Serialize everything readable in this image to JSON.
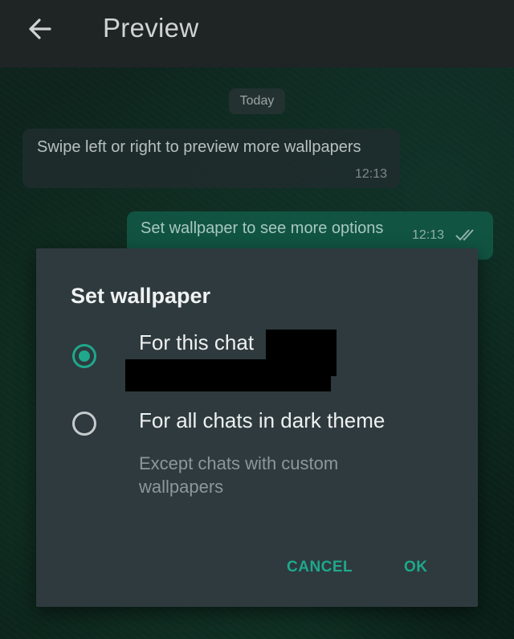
{
  "topbar": {
    "title": "Preview",
    "back_icon": "arrow-left-icon"
  },
  "chat": {
    "date_chip": "Today",
    "incoming": {
      "text": "Swipe left or right to preview more wallpapers",
      "time": "12:13"
    },
    "outgoing": {
      "text": "Set wallpaper to see more options",
      "time": "12:13",
      "status_icon": "double-check-icon"
    }
  },
  "dialog": {
    "title": "Set wallpaper",
    "options": [
      {
        "label": "For this chat",
        "selected": true
      },
      {
        "label": "For all chats in dark theme",
        "subtext": "Except chats with custom wallpapers",
        "selected": false
      }
    ],
    "cancel_label": "CANCEL",
    "ok_label": "OK"
  },
  "colors": {
    "accent": "#1ea88c",
    "dialog_bg": "#2e3a3e",
    "topbar_bg": "#1f2424"
  }
}
